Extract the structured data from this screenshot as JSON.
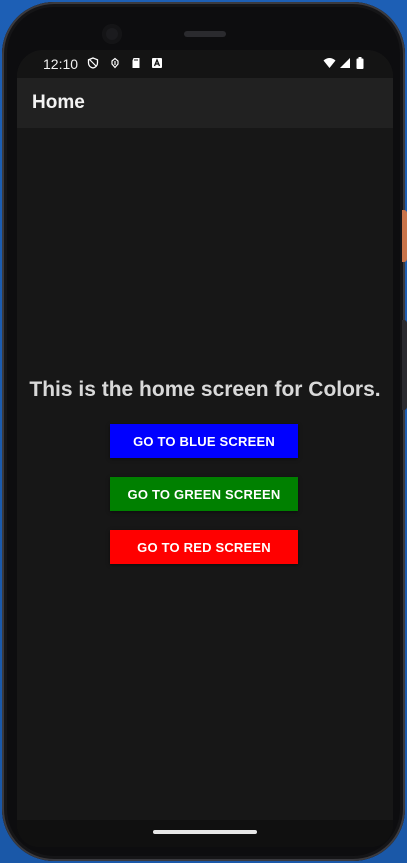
{
  "status_bar": {
    "time": "12:10",
    "left_icons": [
      "shield-outline-icon",
      "usb-debug-icon",
      "sd-card-icon",
      "accessibility-a-icon"
    ],
    "right_icons": [
      "wifi-icon",
      "signal-icon",
      "battery-icon"
    ]
  },
  "app_bar": {
    "title": "Home"
  },
  "main": {
    "headline": "This is the home screen for Colors.",
    "buttons": [
      {
        "label": "GO TO BLUE SCREEN",
        "color": "#0000ff"
      },
      {
        "label": "GO TO GREEN SCREEN",
        "color": "#008000"
      },
      {
        "label": "GO TO RED SCREEN",
        "color": "#ff0000"
      }
    ]
  },
  "colors": {
    "background": "#171717",
    "app_bar": "#212121",
    "headline_text": "#d9d9d9",
    "button_text": "#ffffff"
  }
}
